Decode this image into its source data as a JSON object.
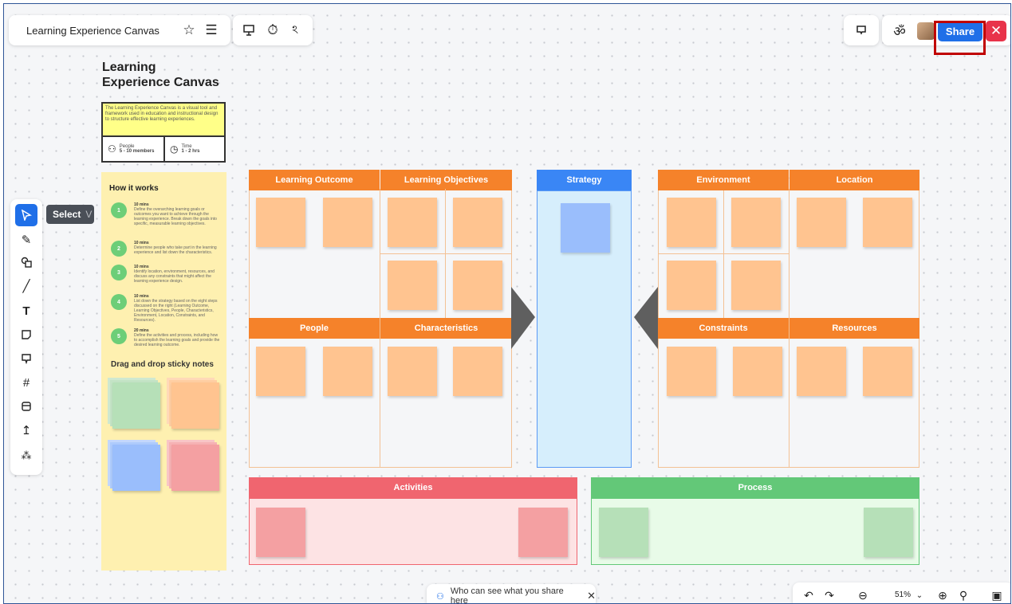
{
  "header": {
    "board_title": "Learning Experience Canvas",
    "share_label": "Share"
  },
  "select_tooltip": {
    "label": "Select",
    "shortcut": "V"
  },
  "left_toolbar": {
    "tools": [
      "select-icon",
      "pen-icon",
      "shapes-icon",
      "line-icon",
      "text-icon",
      "sticky-note-icon",
      "comment-icon",
      "frame-icon",
      "template-icon",
      "upload-icon",
      "more-tools-icon"
    ]
  },
  "canvas": {
    "title_line1": "Learning",
    "title_line2": "Experience Canvas",
    "description": "The Learning Experience Canvas is a visual tool and framework used in education and instructional design to structure effective learning experiences.",
    "people_label": "People",
    "people_value": "5 - 10 members",
    "time_label": "Time",
    "time_value": "1 - 2 hrs",
    "how_title": "How it works",
    "steps": [
      {
        "num": "1",
        "time": "10 mins",
        "text": "Define the overarching learning goals or outcomes you want to achieve through the learning experience. Break down the goals into specific, measurable learning objectives."
      },
      {
        "num": "2",
        "time": "10 mins",
        "text": "Determine people who take part in the learning experience and list down the characteristics."
      },
      {
        "num": "3",
        "time": "10 mins",
        "text": "Identify location, environment, resources, and discuss any constraints that might affect the learning experience design."
      },
      {
        "num": "4",
        "time": "10 mins",
        "text": "List down the strategy based on the eight steps discussed on the right (Learning Outcome, Learning Objectives, People, Characteristics, Environment, Location, Constraints, and Resources)."
      },
      {
        "num": "5",
        "time": "20 mins",
        "text": "Define the activities and process, including how to accomplish the learning goals and provide the desired learning outcome."
      }
    ],
    "drag_title": "Drag and drop sticky notes",
    "sections": {
      "learning_outcome": "Learning Outcome",
      "learning_objectives": "Learning Objectives",
      "strategy": "Strategy",
      "environment": "Environment",
      "location": "Location",
      "people": "People",
      "characteristics": "Characteristics",
      "constraints": "Constraints",
      "resources": "Resources",
      "activities": "Activities",
      "process": "Process"
    }
  },
  "bottom": {
    "share_hint": "Who can see what you share here",
    "zoom_level": "51%"
  },
  "colors": {
    "accent": "#1f6fe8",
    "orange": "#f5822a",
    "strategy_blue": "#3a86f5",
    "activities_red": "#f0656f",
    "process_green": "#63c878",
    "highlight_red": "#c00000"
  }
}
